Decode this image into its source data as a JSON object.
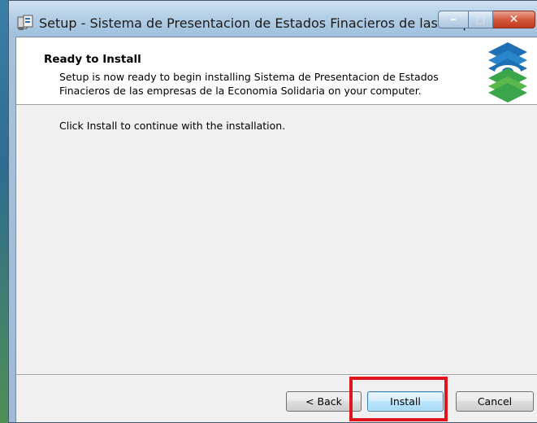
{
  "window": {
    "title": "Setup - Sistema de Presentacion de Estados Finacieros  de las empr...",
    "controls": {
      "minimize": "–",
      "maximize": "□",
      "close": "✕"
    }
  },
  "header": {
    "title": "Ready to Install",
    "description": "Setup is now ready to begin installing Sistema de Presentacion de Estados Finacieros  de las empresas de la Economia Solidaria on your computer."
  },
  "body": {
    "message": "Click Install to continue with the installation."
  },
  "buttons": {
    "back": "< Back",
    "install": "Install",
    "cancel": "Cancel"
  },
  "icons": {
    "app": "installer-icon",
    "logo": "company-logo"
  },
  "colors": {
    "highlight": "#e0141e",
    "logo_blue": "#1f6fb5",
    "logo_green": "#3aa54a"
  }
}
